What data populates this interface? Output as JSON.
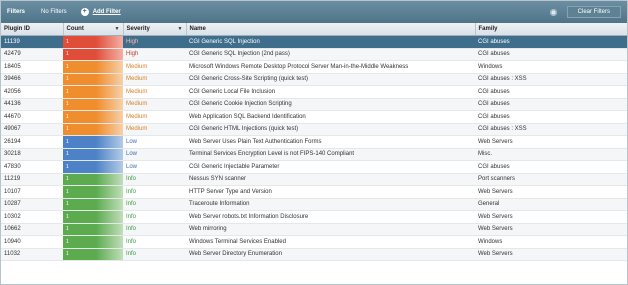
{
  "filterbar": {
    "label": "Filters",
    "value": "No Filters",
    "add_label": "Add Filter",
    "clear_label": "Clear Filters"
  },
  "columns": {
    "plugin_id": "Plugin ID",
    "count": "Count",
    "severity": "Severity",
    "name": "Name",
    "family": "Family"
  },
  "rows": [
    {
      "id": "11139",
      "count": "1",
      "severity": "High",
      "level": "high",
      "name": "CGI Generic SQL Injection",
      "family": "CGI abuses",
      "selected": true
    },
    {
      "id": "42479",
      "count": "1",
      "severity": "High",
      "level": "high",
      "name": "CGI Generic SQL Injection (2nd pass)",
      "family": "CGI abuses"
    },
    {
      "id": "18405",
      "count": "1",
      "severity": "Medium",
      "level": "medium",
      "name": "Microsoft Windows Remote Desktop Protocol Server Man-in-the-Middle Weakness",
      "family": "Windows"
    },
    {
      "id": "39466",
      "count": "1",
      "severity": "Medium",
      "level": "medium",
      "name": "CGI Generic Cross-Site Scripting (quick test)",
      "family": "CGI abuses : XSS"
    },
    {
      "id": "42056",
      "count": "1",
      "severity": "Medium",
      "level": "medium",
      "name": "CGI Generic Local File Inclusion",
      "family": "CGI abuses"
    },
    {
      "id": "44136",
      "count": "1",
      "severity": "Medium",
      "level": "medium",
      "name": "CGI Generic Cookie Injection Scripting",
      "family": "CGI abuses"
    },
    {
      "id": "44670",
      "count": "1",
      "severity": "Medium",
      "level": "medium",
      "name": "Web Application SQL Backend Identification",
      "family": "CGI abuses"
    },
    {
      "id": "49067",
      "count": "1",
      "severity": "Medium",
      "level": "medium",
      "name": "CGI Generic HTML Injections (quick test)",
      "family": "CGI abuses : XSS"
    },
    {
      "id": "26194",
      "count": "1",
      "severity": "Low",
      "level": "low",
      "name": "Web Server Uses Plain Text Authentication Forms",
      "family": "Web Servers"
    },
    {
      "id": "30218",
      "count": "1",
      "severity": "Low",
      "level": "low",
      "name": "Terminal Services Encryption Level is not FIPS-140 Compliant",
      "family": "Misc."
    },
    {
      "id": "47830",
      "count": "1",
      "severity": "Low",
      "level": "low",
      "name": "CGI Generic Injectable Parameter",
      "family": "CGI abuses"
    },
    {
      "id": "11219",
      "count": "1",
      "severity": "Info",
      "level": "info",
      "name": "Nessus SYN scanner",
      "family": "Port scanners"
    },
    {
      "id": "10107",
      "count": "1",
      "severity": "Info",
      "level": "info",
      "name": "HTTP Server Type and Version",
      "family": "Web Servers"
    },
    {
      "id": "10287",
      "count": "1",
      "severity": "Info",
      "level": "info",
      "name": "Traceroute Information",
      "family": "General"
    },
    {
      "id": "10302",
      "count": "1",
      "severity": "Info",
      "level": "info",
      "name": "Web Server robots.txt Information Disclosure",
      "family": "Web Servers"
    },
    {
      "id": "10662",
      "count": "1",
      "severity": "Info",
      "level": "info",
      "name": "Web mirroring",
      "family": "Web Servers"
    },
    {
      "id": "10940",
      "count": "1",
      "severity": "Info",
      "level": "info",
      "name": "Windows Terminal Services Enabled",
      "family": "Windows"
    },
    {
      "id": "11032",
      "count": "1",
      "severity": "Info",
      "level": "info",
      "name": "Web Server Directory Enumeration",
      "family": "Web Servers"
    }
  ],
  "colors": {
    "high": "#e04e3a",
    "medium": "#f08d2c",
    "low": "#4d83c6",
    "info": "#5cab4f",
    "header": "#4f7488",
    "selected_row": "#3f6d8c"
  }
}
